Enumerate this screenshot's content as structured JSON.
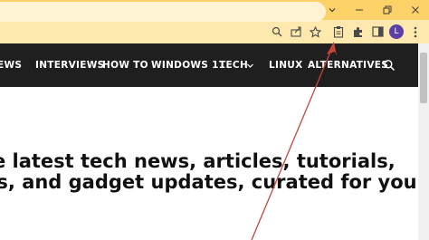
{
  "browser": {
    "window_controls": {
      "tabs_menu_icon": "chevron-down",
      "minimize_icon": "minimize",
      "restore_icon": "restore",
      "close_icon": "close"
    },
    "toolbar": {
      "icons": [
        "search-icon",
        "share-icon",
        "star-icon",
        "clipboard-icon",
        "extensions-icon",
        "side-panel-icon",
        "more-icon"
      ],
      "profile_initial": "L",
      "profile_color": "#5b3ea6"
    },
    "title_color": "#fbd168",
    "toolbar_color": "#fde8ad"
  },
  "site": {
    "nav": {
      "items": [
        "EWS",
        "INTERVIEWS",
        "HOW TO",
        "WINDOWS 11",
        "TECH",
        "LINUX",
        "ALTERNATIVES"
      ],
      "tech_dropdown_icon": "chevron-down",
      "search_icon": "search-icon",
      "background": "#1f1f1f"
    },
    "hero": {
      "line1": "he latest tech news, articles, tutorials,",
      "line2": "ws, and gadget updates, curated for you"
    }
  },
  "annotation": {
    "type": "arrow",
    "color": "#c8453a"
  }
}
